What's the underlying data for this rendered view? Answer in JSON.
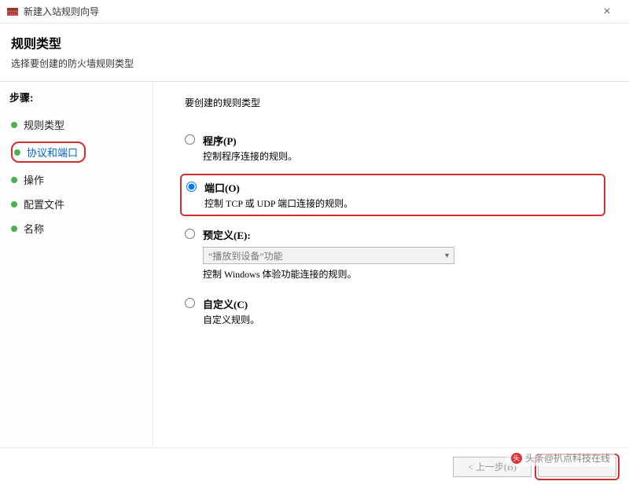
{
  "window": {
    "title": "新建入站规则向导",
    "close": "×"
  },
  "header": {
    "title": "规则类型",
    "subtitle": "选择要创建的防火墙规则类型"
  },
  "sidebar": {
    "steps_label": "步骤:",
    "steps": [
      {
        "label": "规则类型"
      },
      {
        "label": "协议和端口"
      },
      {
        "label": "操作"
      },
      {
        "label": "配置文件"
      },
      {
        "label": "名称"
      }
    ]
  },
  "content": {
    "heading": "要创建的规则类型",
    "options": {
      "program": {
        "label": "程序(P)",
        "desc": "控制程序连接的规则。"
      },
      "port": {
        "label": "端口(O)",
        "desc": "控制 TCP 或 UDP 端口连接的规则。"
      },
      "predefined": {
        "label": "预定义(E):",
        "dropdown": "“播放到设备”功能",
        "desc": "控制 Windows 体验功能连接的规则。"
      },
      "custom": {
        "label": "自定义(C)",
        "desc": "自定义规则。"
      }
    }
  },
  "footer": {
    "back": "< 上一步(B)",
    "next": ""
  },
  "watermark": "头条@扒点科技在线"
}
